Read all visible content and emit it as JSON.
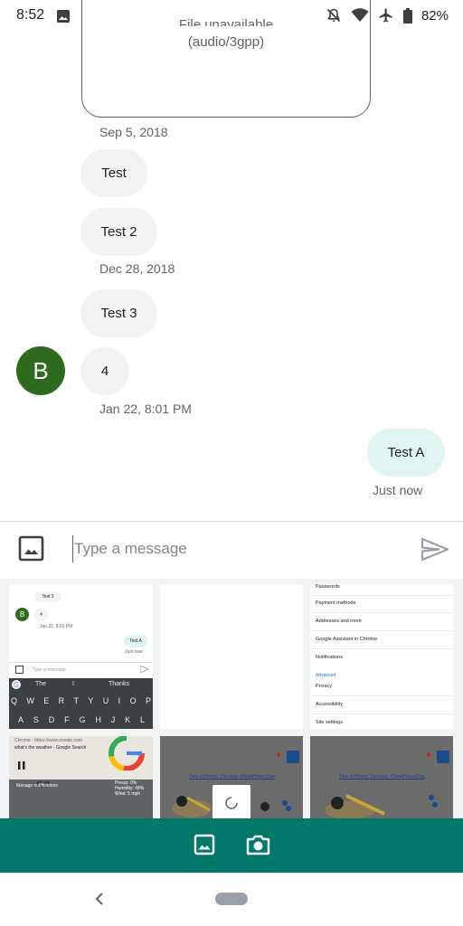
{
  "status_bar": {
    "time": "8:52",
    "battery": "82%"
  },
  "thread": {
    "audio_unavailable": "File unavailable",
    "audio_type": "(audio/3gpp)",
    "date1": "Sep 5, 2018",
    "msg1": "Test",
    "msg2": "Test 2",
    "date2": "Dec 28, 2018",
    "msg3": "Test 3",
    "avatar_letter": "B",
    "msg4": "4",
    "msg4_time": "Jan 22, 8:01 PM",
    "sent_msg": "Test A",
    "sent_status": "Just now"
  },
  "composer": {
    "placeholder": "Type a message"
  },
  "picker": {
    "thumb1": {
      "bubble1": "Test 2",
      "bubble2": "4",
      "time": "Jan 22, 8:01 PM",
      "sent": "Test A",
      "sent_status": "Just now",
      "placeholder": "Type a message",
      "suggest1": "The",
      "suggest2": "I",
      "suggest3": "Thanks",
      "row1": [
        "Q",
        "W",
        "E",
        "R",
        "T",
        "Y",
        "U",
        "I",
        "O",
        "P"
      ],
      "row2": [
        "A",
        "S",
        "D",
        "F",
        "G",
        "H",
        "J",
        "K",
        "L"
      ]
    },
    "thumb3": {
      "items": [
        "Passwords",
        "Payment methods",
        "Addresses and more",
        "Google Assistant in Chrome",
        "Notifications",
        "Advanced",
        "Privacy",
        "Accessibility",
        "Site settings"
      ]
    },
    "thumb4": {
      "search_line1": "Chrome · https://www.google.com",
      "search_line2": "what's the weather - Google Search",
      "temp": "57",
      "manage": "Manage notifications",
      "weather": "Precip: 0%\nHumidity: 49%\nWind: 5 mph"
    },
    "thumb5": {
      "link": "Take a Privacy Checkup. #DataPrivacyDay"
    },
    "thumb6": {
      "link": "Take a Privacy Checkup. #DataPrivacyDay"
    }
  },
  "colors": {
    "accent": "#00796b",
    "avatar": "#2e6b1f",
    "sent_bubble": "#e0f5f2",
    "received_bubble": "#f1f3f4"
  }
}
